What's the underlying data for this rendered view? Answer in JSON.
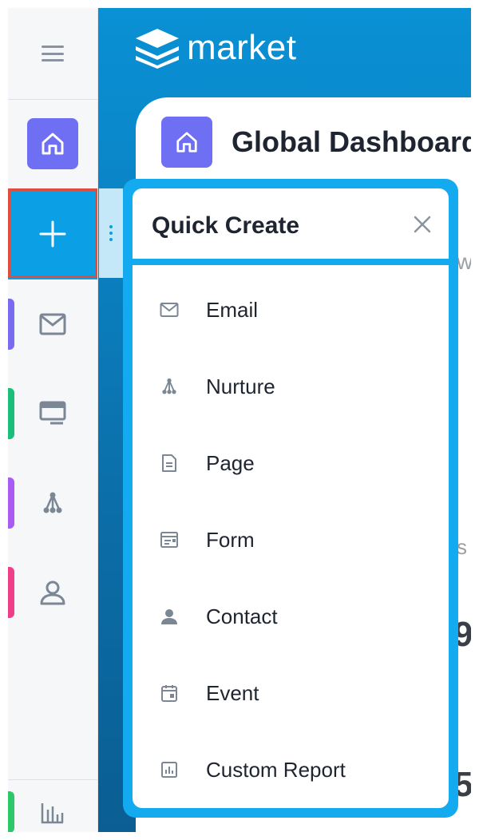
{
  "app": {
    "logo_text": "market"
  },
  "dashboard": {
    "title": "Global Dashboard"
  },
  "rail": {
    "colors": {
      "email": "#7a6cf0",
      "page": "#1bbf7a",
      "nurture": "#a85cf2",
      "contact": "#ef3f8a",
      "bottom": "#2ec86a"
    }
  },
  "quick_create": {
    "title": "Quick Create",
    "close_icon": "close-icon",
    "items": [
      {
        "label": "Email",
        "icon": "email-icon"
      },
      {
        "label": "Nurture",
        "icon": "nurture-icon"
      },
      {
        "label": "Page",
        "icon": "page-icon"
      },
      {
        "label": "Form",
        "icon": "form-icon"
      },
      {
        "label": "Contact",
        "icon": "contact-icon"
      },
      {
        "label": "Event",
        "icon": "event-icon"
      },
      {
        "label": "Custom Report",
        "icon": "custom-report-icon"
      }
    ]
  }
}
